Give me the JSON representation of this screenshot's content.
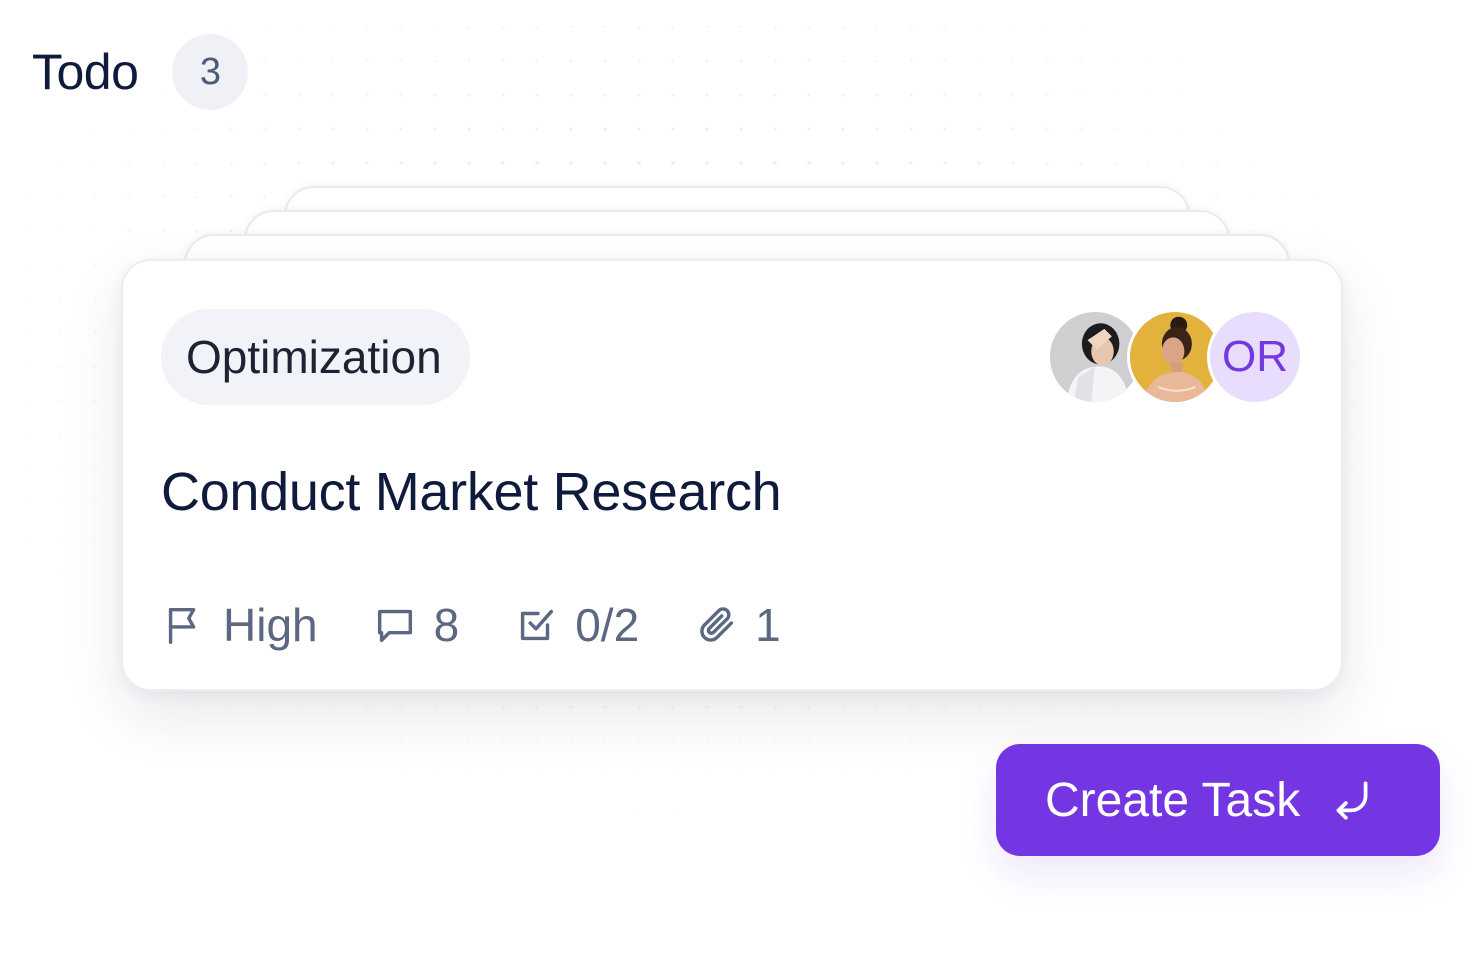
{
  "column": {
    "title": "Todo",
    "count": "3"
  },
  "card": {
    "tag": "Optimization",
    "title": "Conduct Market Research",
    "assignees": [
      {
        "type": "photo",
        "description_icon": "woman-portrait-avatar-1"
      },
      {
        "type": "photo",
        "description_icon": "woman-portrait-avatar-2"
      },
      {
        "type": "initials",
        "initials": "OR"
      }
    ],
    "meta": {
      "priority": "High",
      "comments": "8",
      "subtasks": "0/2",
      "attachments": "1"
    }
  },
  "actions": {
    "create_task_label": "Create Task"
  },
  "colors": {
    "accent": "#7436e2",
    "title_text": "#0f1b3d",
    "meta_text": "#5c6782",
    "initials_bg": "#e8ddfc",
    "initials_text": "#7437e0"
  },
  "icons": {
    "priority": "flag-icon",
    "comments": "comment-icon",
    "subtasks": "checkbox-icon",
    "attachments": "paperclip-icon",
    "create": "enter-arrow-icon"
  }
}
